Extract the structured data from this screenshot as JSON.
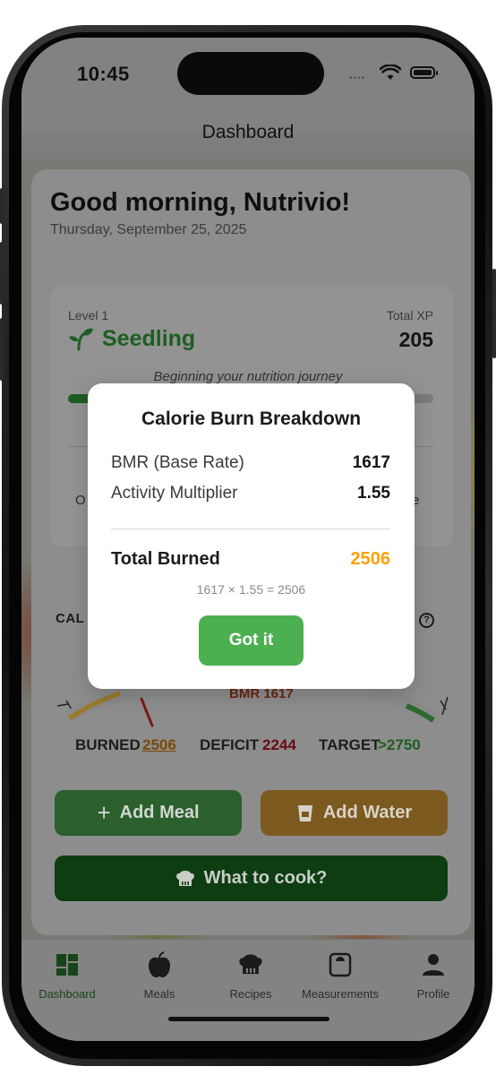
{
  "status": {
    "time": "10:45"
  },
  "nav": {
    "title": "Dashboard"
  },
  "greeting": {
    "title": "Good morning, Nutrivio!",
    "date": "Thursday, September 25, 2025"
  },
  "level": {
    "level_label": "Level 1",
    "name": "Seedling",
    "xp_label": "Total XP",
    "xp_value": "205",
    "subtitle": "Beginning your nutrition journey",
    "progress_fraction": 0.1,
    "left_partial": "O",
    "right_partial": "e"
  },
  "calories": {
    "label_partial": "CAL",
    "bmr_tag": "BMR 1617",
    "burned_label": "BURNED",
    "burned_value": "2506",
    "deficit_label": "DEFICIT",
    "deficit_value": "2244",
    "target_label": "TARGET",
    "target_value": ">2750"
  },
  "actions": {
    "add_meal": "Add Meal",
    "add_water": "Add Water",
    "cook": "What to cook?"
  },
  "tabs": [
    {
      "label": "Dashboard",
      "icon": "dashboard-icon"
    },
    {
      "label": "Meals",
      "icon": "apple-icon"
    },
    {
      "label": "Recipes",
      "icon": "chef-hat-icon"
    },
    {
      "label": "Measurements",
      "icon": "scale-icon"
    },
    {
      "label": "Profile",
      "icon": "person-icon"
    }
  ],
  "modal": {
    "title": "Calorie Burn Breakdown",
    "bmr_label": "BMR (Base Rate)",
    "bmr_value": "1617",
    "activity_label": "Activity Multiplier",
    "activity_value": "1.55",
    "total_label": "Total Burned",
    "total_value": "2506",
    "formula": "1617 × 1.55 = 2506",
    "button": "Got it"
  },
  "colors": {
    "accent_green": "#4caf50",
    "accent_orange": "#ff9f0a",
    "deficit_red": "#b2162a",
    "brand_green": "#2e7d32"
  }
}
